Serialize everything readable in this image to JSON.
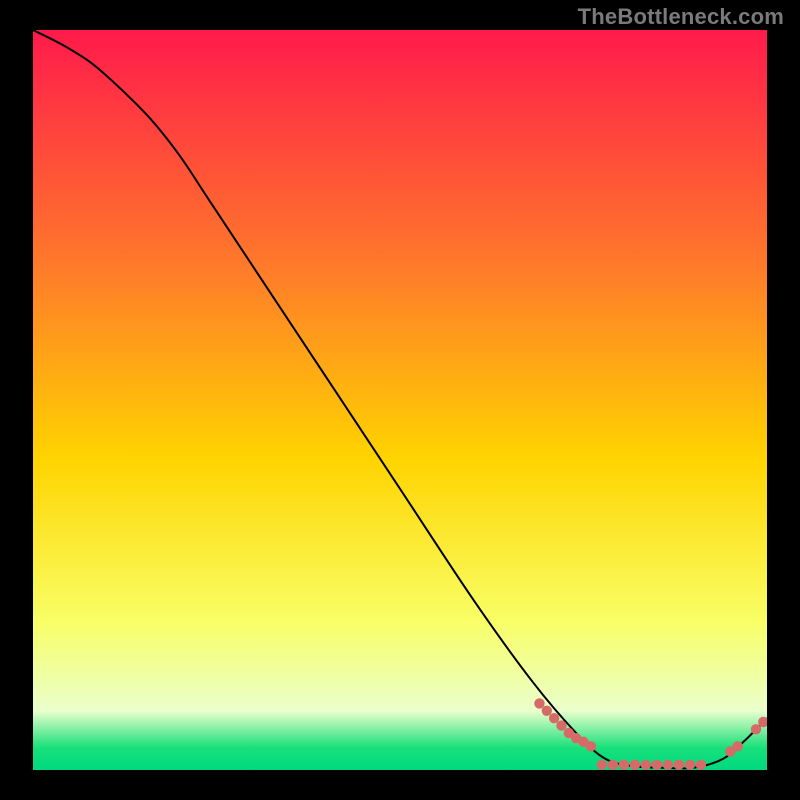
{
  "watermark": "TheBottleneck.com",
  "colors": {
    "gradient_top": "#ff1a4b",
    "gradient_mid1": "#ff7a2a",
    "gradient_mid2": "#ffd400",
    "gradient_mid3": "#f8ff66",
    "gradient_bottom_band": "#eaffcc",
    "gradient_green": "#18e07a",
    "gradient_edge": "#00d980",
    "line": "#000000",
    "marker": "#d66a66"
  },
  "chart_data": {
    "type": "line",
    "title": "",
    "xlabel": "",
    "ylabel": "",
    "xlim": [
      0,
      100
    ],
    "ylim": [
      0,
      100
    ],
    "series": [
      {
        "name": "bottleneck-curve",
        "x": [
          0,
          4,
          8,
          12,
          16,
          20,
          24,
          30,
          40,
          50,
          60,
          68,
          74,
          78,
          82,
          86,
          90,
          94,
          97,
          100
        ],
        "y": [
          100,
          98,
          95.5,
          92,
          88,
          83,
          77,
          68,
          53,
          38,
          23,
          12,
          5,
          1.5,
          0.5,
          0.3,
          0.3,
          1.5,
          4,
          7
        ]
      }
    ],
    "markers": {
      "name": "ideal-band-points",
      "points": [
        {
          "x": 69,
          "y": 9.0
        },
        {
          "x": 70,
          "y": 8.0
        },
        {
          "x": 71,
          "y": 7.0
        },
        {
          "x": 72,
          "y": 6.0
        },
        {
          "x": 73,
          "y": 5.0
        },
        {
          "x": 74,
          "y": 4.3
        },
        {
          "x": 75,
          "y": 3.8
        },
        {
          "x": 76,
          "y": 3.2
        },
        {
          "x": 77.5,
          "y": 0.7
        },
        {
          "x": 79,
          "y": 0.7
        },
        {
          "x": 80.5,
          "y": 0.7
        },
        {
          "x": 82,
          "y": 0.7
        },
        {
          "x": 83.5,
          "y": 0.7
        },
        {
          "x": 85,
          "y": 0.7
        },
        {
          "x": 86.5,
          "y": 0.7
        },
        {
          "x": 88,
          "y": 0.7
        },
        {
          "x": 89.5,
          "y": 0.7
        },
        {
          "x": 91,
          "y": 0.7
        },
        {
          "x": 95,
          "y": 2.5
        },
        {
          "x": 96,
          "y": 3.2
        },
        {
          "x": 98.5,
          "y": 5.5
        },
        {
          "x": 99.5,
          "y": 6.5
        }
      ]
    }
  }
}
